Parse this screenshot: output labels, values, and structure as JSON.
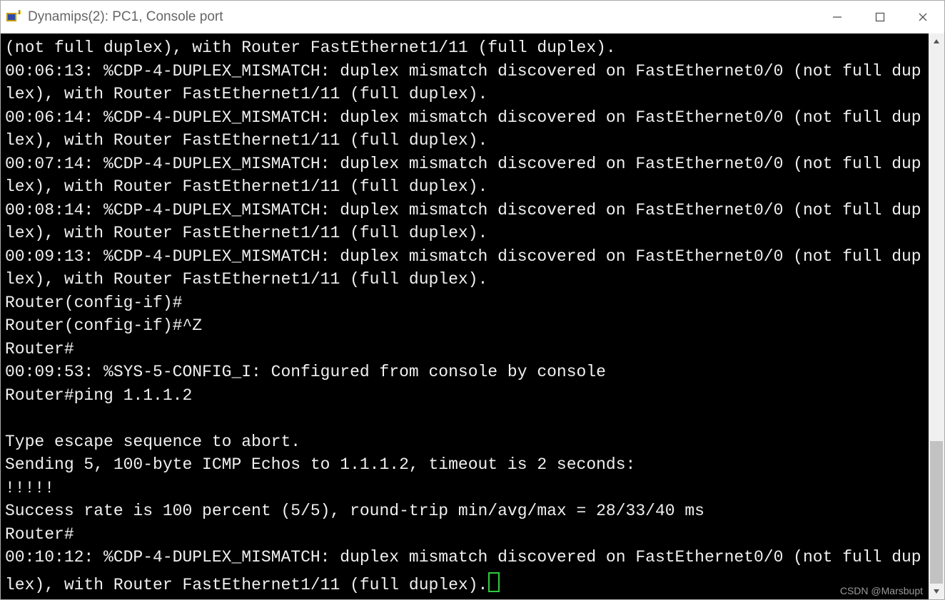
{
  "window": {
    "title": "Dynamips(2): PC1, Console port"
  },
  "terminal": {
    "lines": [
      "(not full duplex), with Router FastEthernet1/11 (full duplex).",
      "00:06:13: %CDP-4-DUPLEX_MISMATCH: duplex mismatch discovered on FastEthernet0/0 (not full duplex), with Router FastEthernet1/11 (full duplex).",
      "00:06:14: %CDP-4-DUPLEX_MISMATCH: duplex mismatch discovered on FastEthernet0/0 (not full duplex), with Router FastEthernet1/11 (full duplex).",
      "00:07:14: %CDP-4-DUPLEX_MISMATCH: duplex mismatch discovered on FastEthernet0/0 (not full duplex), with Router FastEthernet1/11 (full duplex).",
      "00:08:14: %CDP-4-DUPLEX_MISMATCH: duplex mismatch discovered on FastEthernet0/0 (not full duplex), with Router FastEthernet1/11 (full duplex).",
      "00:09:13: %CDP-4-DUPLEX_MISMATCH: duplex mismatch discovered on FastEthernet0/0 (not full duplex), with Router FastEthernet1/11 (full duplex).",
      "Router(config-if)#",
      "Router(config-if)#^Z",
      "Router#",
      "00:09:53: %SYS-5-CONFIG_I: Configured from console by console",
      "Router#ping 1.1.1.2",
      "",
      "Type escape sequence to abort.",
      "Sending 5, 100-byte ICMP Echos to 1.1.1.2, timeout is 2 seconds:",
      "!!!!!",
      "Success rate is 100 percent (5/5), round-trip min/avg/max = 28/33/40 ms",
      "Router#",
      "00:10:12: %CDP-4-DUPLEX_MISMATCH: duplex mismatch discovered on FastEthernet0/0 (not full duplex), with Router FastEthernet1/11 (full duplex)."
    ]
  },
  "watermark": "CSDN @Marsbupt"
}
